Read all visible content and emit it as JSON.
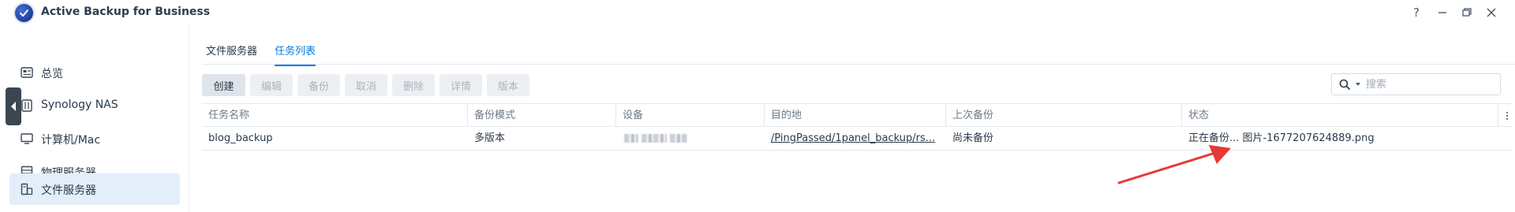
{
  "titlebar": {
    "app_title": "Active Backup for Business",
    "help_glyph": "?",
    "min_glyph": "—",
    "restore_glyph": "❐",
    "close_glyph": "✕"
  },
  "sidebar": {
    "items": [
      {
        "label": "总览",
        "icon": "overview-icon"
      },
      {
        "label": "Synology NAS",
        "icon": "nas-icon"
      },
      {
        "label": "计算机/Mac",
        "icon": "computer-icon"
      },
      {
        "label": "物理服务器",
        "icon": "server-icon"
      },
      {
        "label": "文件服务器",
        "icon": "file-server-icon",
        "active": true
      }
    ]
  },
  "tabs": [
    {
      "label": "文件服务器"
    },
    {
      "label": "任务列表",
      "active": true
    }
  ],
  "toolbar": {
    "create": "创建",
    "edit": "编辑",
    "backup": "备份",
    "cancel": "取消",
    "delete": "删除",
    "details": "详情",
    "version": "版本"
  },
  "search": {
    "placeholder": "搜索"
  },
  "table": {
    "columns": [
      "任务名称",
      "备份模式",
      "设备",
      "目的地",
      "上次备份",
      "状态"
    ],
    "rows": [
      {
        "name": "blog_backup",
        "mode": "多版本",
        "device": "",
        "destination": "/PingPassed/1panel_backup/rs...",
        "last_backup": "尚未备份",
        "status": "正在备份... 图片-1677207624889.png"
      }
    ]
  },
  "colors": {
    "accent": "#0a7ce0",
    "sidebar_active_bg": "#e4eefb",
    "annotation_arrow": "#e53935"
  }
}
